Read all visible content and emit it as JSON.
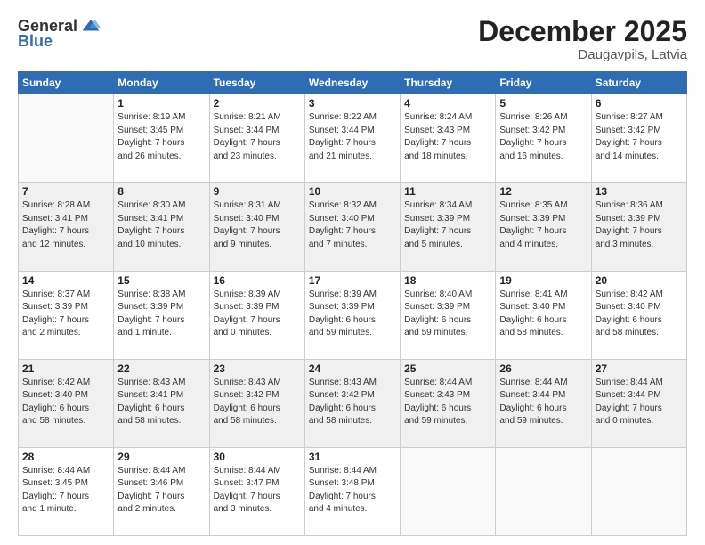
{
  "logo": {
    "general": "General",
    "blue": "Blue"
  },
  "title": "December 2025",
  "location": "Daugavpils, Latvia",
  "days_header": [
    "Sunday",
    "Monday",
    "Tuesday",
    "Wednesday",
    "Thursday",
    "Friday",
    "Saturday"
  ],
  "weeks": [
    [
      {
        "day": "",
        "info": ""
      },
      {
        "day": "1",
        "info": "Sunrise: 8:19 AM\nSunset: 3:45 PM\nDaylight: 7 hours\nand 26 minutes."
      },
      {
        "day": "2",
        "info": "Sunrise: 8:21 AM\nSunset: 3:44 PM\nDaylight: 7 hours\nand 23 minutes."
      },
      {
        "day": "3",
        "info": "Sunrise: 8:22 AM\nSunset: 3:44 PM\nDaylight: 7 hours\nand 21 minutes."
      },
      {
        "day": "4",
        "info": "Sunrise: 8:24 AM\nSunset: 3:43 PM\nDaylight: 7 hours\nand 18 minutes."
      },
      {
        "day": "5",
        "info": "Sunrise: 8:26 AM\nSunset: 3:42 PM\nDaylight: 7 hours\nand 16 minutes."
      },
      {
        "day": "6",
        "info": "Sunrise: 8:27 AM\nSunset: 3:42 PM\nDaylight: 7 hours\nand 14 minutes."
      }
    ],
    [
      {
        "day": "7",
        "info": "Sunrise: 8:28 AM\nSunset: 3:41 PM\nDaylight: 7 hours\nand 12 minutes."
      },
      {
        "day": "8",
        "info": "Sunrise: 8:30 AM\nSunset: 3:41 PM\nDaylight: 7 hours\nand 10 minutes."
      },
      {
        "day": "9",
        "info": "Sunrise: 8:31 AM\nSunset: 3:40 PM\nDaylight: 7 hours\nand 9 minutes."
      },
      {
        "day": "10",
        "info": "Sunrise: 8:32 AM\nSunset: 3:40 PM\nDaylight: 7 hours\nand 7 minutes."
      },
      {
        "day": "11",
        "info": "Sunrise: 8:34 AM\nSunset: 3:39 PM\nDaylight: 7 hours\nand 5 minutes."
      },
      {
        "day": "12",
        "info": "Sunrise: 8:35 AM\nSunset: 3:39 PM\nDaylight: 7 hours\nand 4 minutes."
      },
      {
        "day": "13",
        "info": "Sunrise: 8:36 AM\nSunset: 3:39 PM\nDaylight: 7 hours\nand 3 minutes."
      }
    ],
    [
      {
        "day": "14",
        "info": "Sunrise: 8:37 AM\nSunset: 3:39 PM\nDaylight: 7 hours\nand 2 minutes."
      },
      {
        "day": "15",
        "info": "Sunrise: 8:38 AM\nSunset: 3:39 PM\nDaylight: 7 hours\nand 1 minute."
      },
      {
        "day": "16",
        "info": "Sunrise: 8:39 AM\nSunset: 3:39 PM\nDaylight: 7 hours\nand 0 minutes."
      },
      {
        "day": "17",
        "info": "Sunrise: 8:39 AM\nSunset: 3:39 PM\nDaylight: 6 hours\nand 59 minutes."
      },
      {
        "day": "18",
        "info": "Sunrise: 8:40 AM\nSunset: 3:39 PM\nDaylight: 6 hours\nand 59 minutes."
      },
      {
        "day": "19",
        "info": "Sunrise: 8:41 AM\nSunset: 3:40 PM\nDaylight: 6 hours\nand 58 minutes."
      },
      {
        "day": "20",
        "info": "Sunrise: 8:42 AM\nSunset: 3:40 PM\nDaylight: 6 hours\nand 58 minutes."
      }
    ],
    [
      {
        "day": "21",
        "info": "Sunrise: 8:42 AM\nSunset: 3:40 PM\nDaylight: 6 hours\nand 58 minutes."
      },
      {
        "day": "22",
        "info": "Sunrise: 8:43 AM\nSunset: 3:41 PM\nDaylight: 6 hours\nand 58 minutes."
      },
      {
        "day": "23",
        "info": "Sunrise: 8:43 AM\nSunset: 3:42 PM\nDaylight: 6 hours\nand 58 minutes."
      },
      {
        "day": "24",
        "info": "Sunrise: 8:43 AM\nSunset: 3:42 PM\nDaylight: 6 hours\nand 58 minutes."
      },
      {
        "day": "25",
        "info": "Sunrise: 8:44 AM\nSunset: 3:43 PM\nDaylight: 6 hours\nand 59 minutes."
      },
      {
        "day": "26",
        "info": "Sunrise: 8:44 AM\nSunset: 3:44 PM\nDaylight: 6 hours\nand 59 minutes."
      },
      {
        "day": "27",
        "info": "Sunrise: 8:44 AM\nSunset: 3:44 PM\nDaylight: 7 hours\nand 0 minutes."
      }
    ],
    [
      {
        "day": "28",
        "info": "Sunrise: 8:44 AM\nSunset: 3:45 PM\nDaylight: 7 hours\nand 1 minute."
      },
      {
        "day": "29",
        "info": "Sunrise: 8:44 AM\nSunset: 3:46 PM\nDaylight: 7 hours\nand 2 minutes."
      },
      {
        "day": "30",
        "info": "Sunrise: 8:44 AM\nSunset: 3:47 PM\nDaylight: 7 hours\nand 3 minutes."
      },
      {
        "day": "31",
        "info": "Sunrise: 8:44 AM\nSunset: 3:48 PM\nDaylight: 7 hours\nand 4 minutes."
      },
      {
        "day": "",
        "info": ""
      },
      {
        "day": "",
        "info": ""
      },
      {
        "day": "",
        "info": ""
      }
    ]
  ]
}
